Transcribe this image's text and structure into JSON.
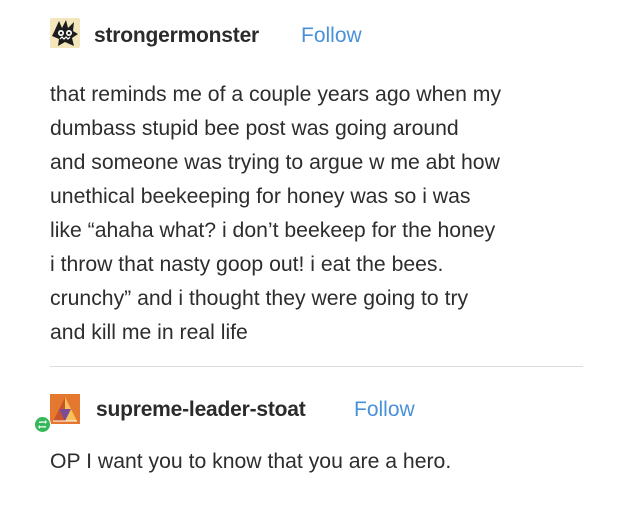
{
  "posts": [
    {
      "username": "strongermonster",
      "follow_label": "Follow",
      "avatar_icon": "dark-creature-avatar-icon",
      "lines": [
        "that reminds me of a couple years ago when my",
        "dumbass stupid bee post was going around",
        "and someone was trying to argue w me abt how",
        "unethical beekeeping for honey was so i was",
        "like “ahaha what? i don’t beekeep for the honey",
        "i throw that nasty goop out! i eat the bees.",
        "crunchy” and i thought they were going to try",
        "and kill me in real life"
      ]
    },
    {
      "username": "supreme-leader-stoat",
      "follow_label": "Follow",
      "avatar_icon": "orange-geometric-avatar-icon",
      "reblog_icon": "reblog-icon",
      "lines": [
        "OP I want you to know that you are a hero."
      ]
    }
  ],
  "colors": {
    "follow": "#4a91d9",
    "text": "#2d2d2d",
    "divider": "#dcdcdc",
    "reblog_badge": "#35b85a"
  }
}
